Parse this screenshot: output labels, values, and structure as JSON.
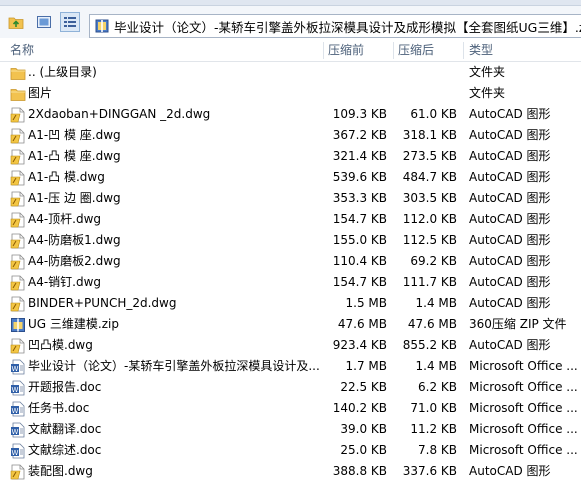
{
  "address": {
    "path": "毕业设计（论文）-某轿车引擎盖外板拉深模具设计及成形模拟【全套图纸UG三维】.zip\\"
  },
  "columns": {
    "name": "名称",
    "size": "压缩前",
    "packed": "压缩后",
    "type": "类型"
  },
  "files": [
    {
      "name": ".. (上级目录)",
      "size": "",
      "packed": "",
      "type": "文件夹",
      "icon": "folder-icon"
    },
    {
      "name": "图片",
      "size": "",
      "packed": "",
      "type": "文件夹",
      "icon": "folder-icon"
    },
    {
      "name": "2Xdaoban+DINGGAN _2d.dwg",
      "size": "109.3 KB",
      "packed": "61.0 KB",
      "type": "AutoCAD 图形",
      "icon": "dwg-icon"
    },
    {
      "name": "A1-凹 模 座.dwg",
      "size": "367.2 KB",
      "packed": "318.1 KB",
      "type": "AutoCAD 图形",
      "icon": "dwg-icon"
    },
    {
      "name": "A1-凸 模 座.dwg",
      "size": "321.4 KB",
      "packed": "273.5 KB",
      "type": "AutoCAD 图形",
      "icon": "dwg-icon"
    },
    {
      "name": "A1-凸 模.dwg",
      "size": "539.6 KB",
      "packed": "484.7 KB",
      "type": "AutoCAD 图形",
      "icon": "dwg-icon"
    },
    {
      "name": "A1-压 边 圈.dwg",
      "size": "353.3 KB",
      "packed": "303.5 KB",
      "type": "AutoCAD 图形",
      "icon": "dwg-icon"
    },
    {
      "name": "A4-顶杆.dwg",
      "size": "154.7 KB",
      "packed": "112.0 KB",
      "type": "AutoCAD 图形",
      "icon": "dwg-icon"
    },
    {
      "name": "A4-防磨板1.dwg",
      "size": "155.0 KB",
      "packed": "112.5 KB",
      "type": "AutoCAD 图形",
      "icon": "dwg-icon"
    },
    {
      "name": "A4-防磨板2.dwg",
      "size": "110.4 KB",
      "packed": "69.2 KB",
      "type": "AutoCAD 图形",
      "icon": "dwg-icon"
    },
    {
      "name": "A4-销钉.dwg",
      "size": "154.7 KB",
      "packed": "111.7 KB",
      "type": "AutoCAD 图形",
      "icon": "dwg-icon"
    },
    {
      "name": "BINDER+PUNCH_2d.dwg",
      "size": "1.5 MB",
      "packed": "1.4 MB",
      "type": "AutoCAD 图形",
      "icon": "dwg-icon"
    },
    {
      "name": "UG 三维建模.zip",
      "size": "47.6 MB",
      "packed": "47.6 MB",
      "type": "360压缩 ZIP 文件",
      "icon": "zip-icon"
    },
    {
      "name": "凹凸模.dwg",
      "size": "923.4 KB",
      "packed": "855.2 KB",
      "type": "AutoCAD 图形",
      "icon": "dwg-icon"
    },
    {
      "name": "毕业设计（论文）-某轿车引擎盖外板拉深模具设计及...",
      "size": "1.7 MB",
      "packed": "1.4 MB",
      "type": "Microsoft Office ...",
      "icon": "doc-icon"
    },
    {
      "name": "开题报告.doc",
      "size": "22.5 KB",
      "packed": "6.2 KB",
      "type": "Microsoft Office ...",
      "icon": "doc-icon"
    },
    {
      "name": "任务书.doc",
      "size": "140.2 KB",
      "packed": "71.0 KB",
      "type": "Microsoft Office ...",
      "icon": "doc-icon"
    },
    {
      "name": "文献翻译.doc",
      "size": "39.0 KB",
      "packed": "11.2 KB",
      "type": "Microsoft Office ...",
      "icon": "doc-icon"
    },
    {
      "name": "文献综述.doc",
      "size": "25.0 KB",
      "packed": "7.8 KB",
      "type": "Microsoft Office ...",
      "icon": "doc-icon"
    },
    {
      "name": "装配图.dwg",
      "size": "388.8 KB",
      "packed": "337.6 KB",
      "type": "AutoCAD 图形",
      "icon": "dwg-icon"
    }
  ],
  "colors": {
    "header_text": "#4c607a",
    "folder": "#f2c24f",
    "dwg_yellow": "#f3c644",
    "doc_blue": "#2f5fa8"
  }
}
